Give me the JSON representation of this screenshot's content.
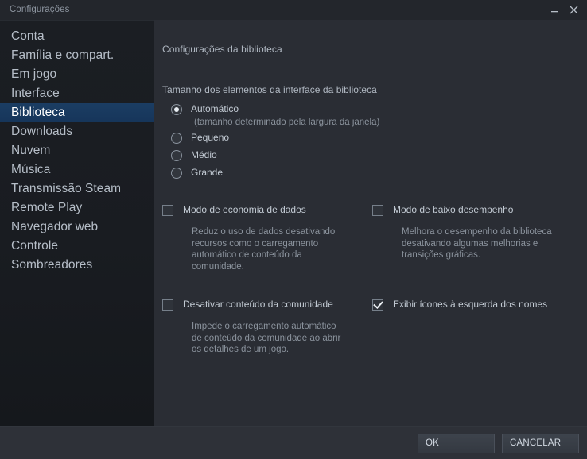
{
  "window": {
    "title": "Configurações",
    "minimize_icon": "minimize-icon",
    "close_icon": "close-icon"
  },
  "sidebar": {
    "items": [
      {
        "label": "Conta",
        "selected": false
      },
      {
        "label": "Família e compart.",
        "selected": false
      },
      {
        "label": "Em jogo",
        "selected": false
      },
      {
        "label": "Interface",
        "selected": false
      },
      {
        "label": "Biblioteca",
        "selected": true
      },
      {
        "label": "Downloads",
        "selected": false
      },
      {
        "label": "Nuvem",
        "selected": false
      },
      {
        "label": "Música",
        "selected": false
      },
      {
        "label": "Transmissão Steam",
        "selected": false
      },
      {
        "label": "Remote Play",
        "selected": false
      },
      {
        "label": "Navegador web",
        "selected": false
      },
      {
        "label": "Controle",
        "selected": false
      },
      {
        "label": "Sombreadores",
        "selected": false
      }
    ]
  },
  "content": {
    "header": "Configurações da biblioteca",
    "size_section_label": "Tamanho dos elementos da interface da biblioteca",
    "size_options": [
      {
        "label": "Automático",
        "sub": "(tamanho determinado pela largura da janela)",
        "selected": true
      },
      {
        "label": "Pequeno",
        "sub": "",
        "selected": false
      },
      {
        "label": "Médio",
        "sub": "",
        "selected": false
      },
      {
        "label": "Grande",
        "sub": "",
        "selected": false
      }
    ],
    "checkboxes": [
      {
        "label": "Modo de economia de dados",
        "desc": "Reduz o uso de dados desativando recursos como o carregamento automático de conteúdo da comunidade.",
        "checked": false
      },
      {
        "label": "Modo de baixo desempenho",
        "desc": "Melhora o desempenho da biblioteca desativando algumas melhorias e transições gráficas.",
        "checked": false
      },
      {
        "label": "Desativar conteúdo da comunidade",
        "desc": "Impede o carregamento automático de conteúdo da comunidade ao abrir os detalhes de um jogo.",
        "checked": false
      },
      {
        "label": "Exibir ícones à esquerda dos nomes",
        "desc": "",
        "checked": true
      }
    ]
  },
  "footer": {
    "ok_label": "OK",
    "cancel_label": "CANCELAR"
  },
  "colors": {
    "window_bg": "#2a2d34",
    "titlebar_bg": "#23262c",
    "sidebar_bg": "#181b1f",
    "selection_blue": "#1b3a5c",
    "text_primary": "#c6d4df",
    "text_muted": "#8b939d"
  }
}
